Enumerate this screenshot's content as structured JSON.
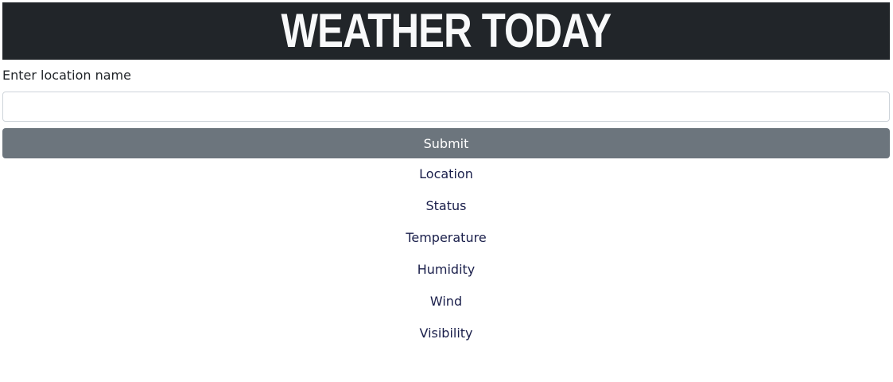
{
  "header": {
    "title": "WEATHER TODAY",
    "background": "#212529",
    "text_color": "#f8f9fa"
  },
  "form": {
    "label": "Enter location name",
    "input_value": "",
    "input_placeholder": "",
    "submit_label": "Submit",
    "submit_color": "#6c757d"
  },
  "results": {
    "location": "Location",
    "status": "Status",
    "temperature": "Temperature",
    "humidity": "Humidity",
    "wind": "Wind",
    "visibility": "Visibility"
  }
}
